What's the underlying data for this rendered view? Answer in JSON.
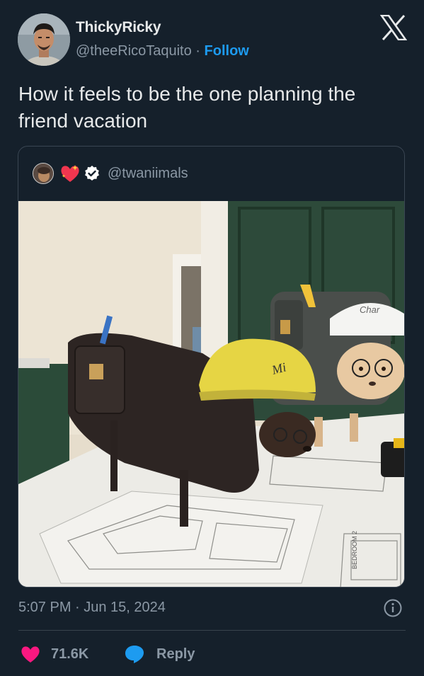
{
  "author": {
    "display_name": "ThickyRicky",
    "handle": "@theeRicoTaquito",
    "separator": "·",
    "follow_label": "Follow"
  },
  "platform_icon": "x-logo-icon",
  "tweet": {
    "text": "How it feels to be the one planning the friend vacation"
  },
  "quoted": {
    "handle": "@twaniimals",
    "icons": [
      "avatar",
      "sparkle-heart-icon",
      "verified-badge-icon"
    ],
    "photo": {
      "helmet_labels": [
        "Char",
        "Mi"
      ],
      "blueprint_label": "BEDROOM 2"
    }
  },
  "timestamp": "5:07 PM · Jun 15, 2024",
  "actions": {
    "like_count": "71.6K",
    "reply_label": "Reply",
    "like_icon": "heart-icon",
    "reply_icon": "reply-bubble-icon",
    "info_icon": "info-icon"
  },
  "colors": {
    "background": "#15202b",
    "accent": "#1d9bf0",
    "like": "#f91880",
    "muted": "#8b98a5"
  }
}
